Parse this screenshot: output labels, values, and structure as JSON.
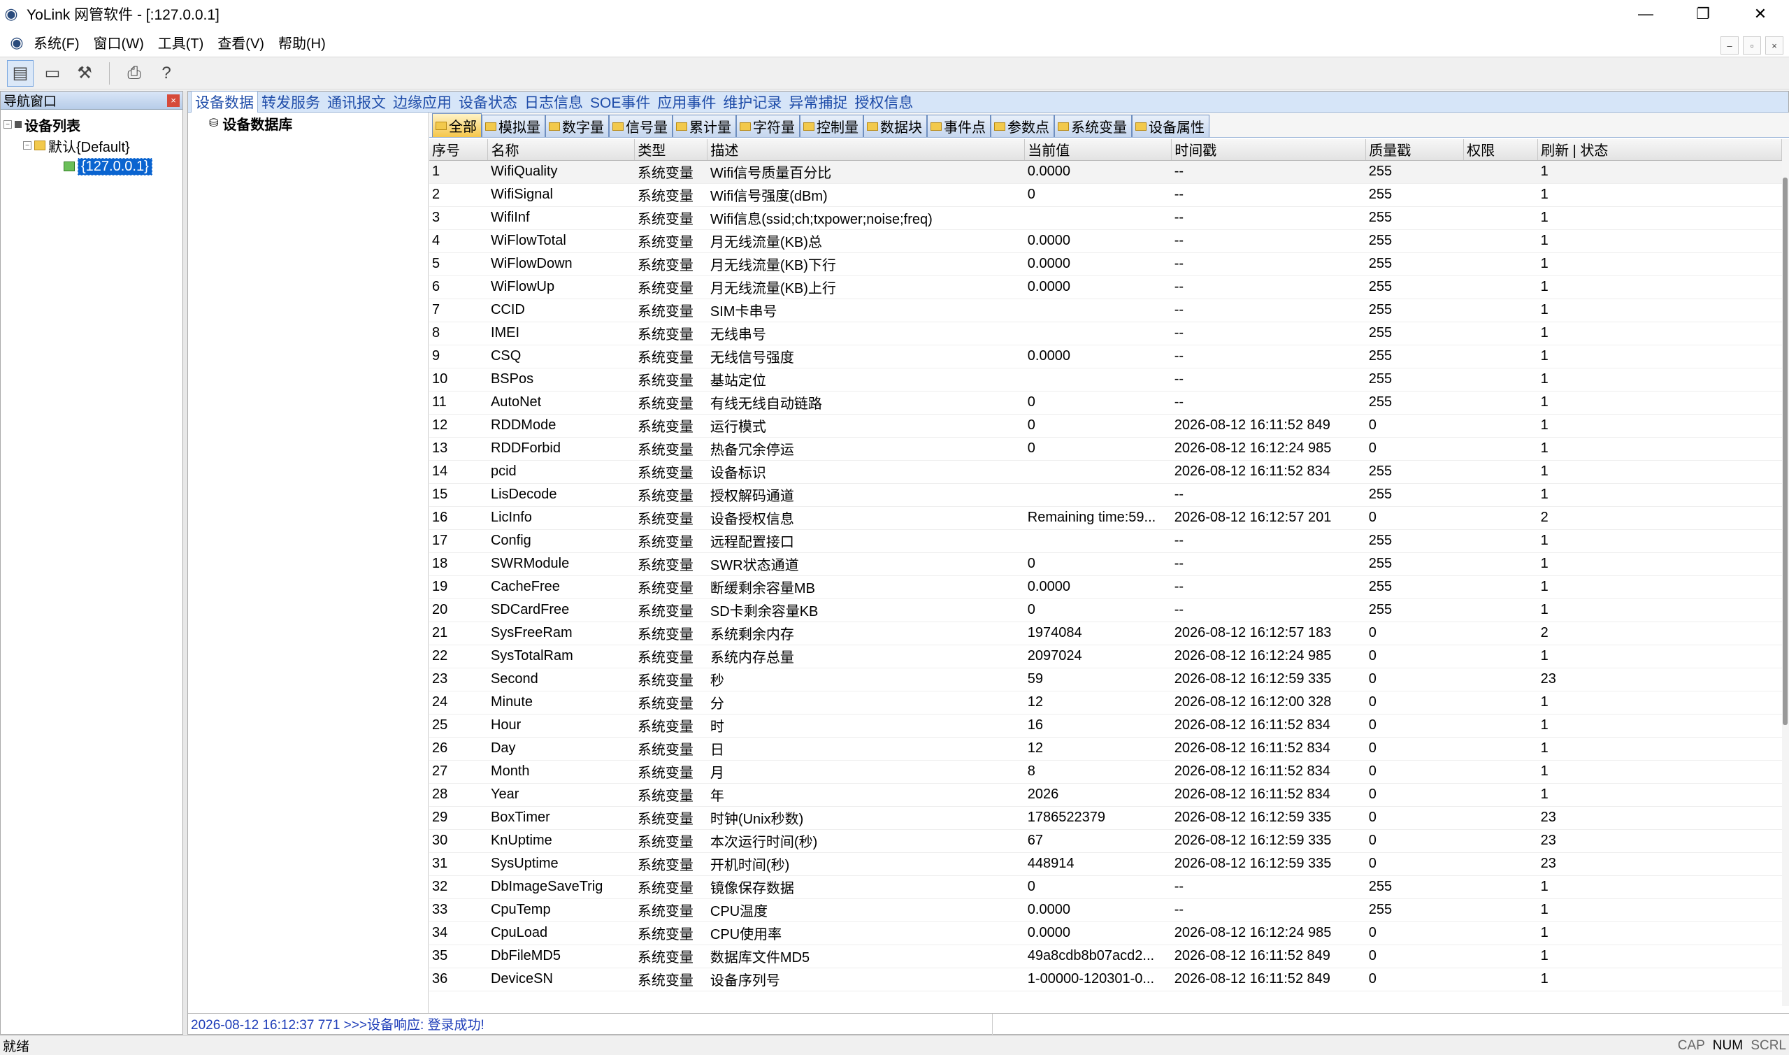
{
  "window": {
    "title": "YoLink 网管软件 - [:127.0.0.1]"
  },
  "menu": [
    "系统(F)",
    "窗口(W)",
    "工具(T)",
    "查看(V)",
    "帮助(H)"
  ],
  "nav": {
    "title": "导航窗口",
    "tree": {
      "root": "设备列表",
      "group": "默认{Default}",
      "device": "{127.0.0.1}"
    }
  },
  "tabs": [
    "设备数据",
    "转发服务",
    "通讯报文",
    "边缘应用",
    "设备状态",
    "日志信息",
    "SOE事件",
    "应用事件",
    "维护记录",
    "异常捕捉",
    "授权信息"
  ],
  "db_node": "设备数据库",
  "subtabs": [
    "全部",
    "模拟量",
    "数字量",
    "信号量",
    "累计量",
    "字符量",
    "控制量",
    "数据块",
    "事件点",
    "参数点",
    "系统变量",
    "设备属性"
  ],
  "columns": [
    "序号",
    "名称",
    "类型",
    "描述",
    "当前值",
    "时间戳",
    "质量戳",
    "权限",
    "刷新 | 状态"
  ],
  "rows": [
    [
      "1",
      "WifiQuality",
      "系统变量",
      "Wifi信号质量百分比",
      "0.0000",
      "--",
      "255",
      "",
      "1"
    ],
    [
      "2",
      "WifiSignal",
      "系统变量",
      "Wifi信号强度(dBm)",
      "0",
      "--",
      "255",
      "",
      "1"
    ],
    [
      "3",
      "WifiInf",
      "系统变量",
      "Wifi信息(ssid;ch;txpower;noise;freq)",
      "",
      "--",
      "255",
      "",
      "1"
    ],
    [
      "4",
      "WiFlowTotal",
      "系统变量",
      "月无线流量(KB)总",
      "0.0000",
      "--",
      "255",
      "",
      "1"
    ],
    [
      "5",
      "WiFlowDown",
      "系统变量",
      "月无线流量(KB)下行",
      "0.0000",
      "--",
      "255",
      "",
      "1"
    ],
    [
      "6",
      "WiFlowUp",
      "系统变量",
      "月无线流量(KB)上行",
      "0.0000",
      "--",
      "255",
      "",
      "1"
    ],
    [
      "7",
      "CCID",
      "系统变量",
      "SIM卡串号",
      "",
      "--",
      "255",
      "",
      "1"
    ],
    [
      "8",
      "IMEI",
      "系统变量",
      "无线串号",
      "",
      "--",
      "255",
      "",
      "1"
    ],
    [
      "9",
      "CSQ",
      "系统变量",
      "无线信号强度",
      "0.0000",
      "--",
      "255",
      "",
      "1"
    ],
    [
      "10",
      "BSPos",
      "系统变量",
      "基站定位",
      "",
      "--",
      "255",
      "",
      "1"
    ],
    [
      "11",
      "AutoNet",
      "系统变量",
      "有线无线自动链路",
      "0",
      "--",
      "255",
      "",
      "1"
    ],
    [
      "12",
      "RDDMode",
      "系统变量",
      "运行模式",
      "0",
      "2026-08-12 16:11:52 849",
      "0",
      "",
      "1"
    ],
    [
      "13",
      "RDDForbid",
      "系统变量",
      "热备冗余停运",
      "0",
      "2026-08-12 16:12:24 985",
      "0",
      "",
      "1"
    ],
    [
      "14",
      "pcid",
      "系统变量",
      "设备标识",
      "",
      "2026-08-12 16:11:52 834",
      "255",
      "",
      "1"
    ],
    [
      "15",
      "LisDecode",
      "系统变量",
      "授权解码通道",
      "",
      "--",
      "255",
      "",
      "1"
    ],
    [
      "16",
      "LicInfo",
      "系统变量",
      "设备授权信息",
      "Remaining time:59...",
      "2026-08-12 16:12:57 201",
      "0",
      "",
      "2"
    ],
    [
      "17",
      "Config",
      "系统变量",
      "远程配置接口",
      "",
      "--",
      "255",
      "",
      "1"
    ],
    [
      "18",
      "SWRModule",
      "系统变量",
      "SWR状态通道",
      "0",
      "--",
      "255",
      "",
      "1"
    ],
    [
      "19",
      "CacheFree",
      "系统变量",
      "断缓剩余容量MB",
      "0.0000",
      "--",
      "255",
      "",
      "1"
    ],
    [
      "20",
      "SDCardFree",
      "系统变量",
      "SD卡剩余容量KB",
      "0",
      "--",
      "255",
      "",
      "1"
    ],
    [
      "21",
      "SysFreeRam",
      "系统变量",
      "系统剩余内存",
      "1974084",
      "2026-08-12 16:12:57 183",
      "0",
      "",
      "2"
    ],
    [
      "22",
      "SysTotalRam",
      "系统变量",
      "系统内存总量",
      "2097024",
      "2026-08-12 16:12:24 985",
      "0",
      "",
      "1"
    ],
    [
      "23",
      "Second",
      "系统变量",
      "秒",
      "59",
      "2026-08-12 16:12:59 335",
      "0",
      "",
      "23"
    ],
    [
      "24",
      "Minute",
      "系统变量",
      "分",
      "12",
      "2026-08-12 16:12:00 328",
      "0",
      "",
      "1"
    ],
    [
      "25",
      "Hour",
      "系统变量",
      "时",
      "16",
      "2026-08-12 16:11:52 834",
      "0",
      "",
      "1"
    ],
    [
      "26",
      "Day",
      "系统变量",
      "日",
      "12",
      "2026-08-12 16:11:52 834",
      "0",
      "",
      "1"
    ],
    [
      "27",
      "Month",
      "系统变量",
      "月",
      "8",
      "2026-08-12 16:11:52 834",
      "0",
      "",
      "1"
    ],
    [
      "28",
      "Year",
      "系统变量",
      "年",
      "2026",
      "2026-08-12 16:11:52 834",
      "0",
      "",
      "1"
    ],
    [
      "29",
      "BoxTimer",
      "系统变量",
      "时钟(Unix秒数)",
      "1786522379",
      "2026-08-12 16:12:59 335",
      "0",
      "",
      "23"
    ],
    [
      "30",
      "KnUptime",
      "系统变量",
      "本次运行时间(秒)",
      "67",
      "2026-08-12 16:12:59 335",
      "0",
      "",
      "23"
    ],
    [
      "31",
      "SysUptime",
      "系统变量",
      "开机时间(秒)",
      "448914",
      "2026-08-12 16:12:59 335",
      "0",
      "",
      "23"
    ],
    [
      "32",
      "DbImageSaveTrig",
      "系统变量",
      "镜像保存数据",
      "0",
      "--",
      "255",
      "",
      "1"
    ],
    [
      "33",
      "CpuTemp",
      "系统变量",
      "CPU温度",
      "0.0000",
      "--",
      "255",
      "",
      "1"
    ],
    [
      "34",
      "CpuLoad",
      "系统变量",
      "CPU使用率",
      "0.0000",
      "2026-08-12 16:12:24 985",
      "0",
      "",
      "1"
    ],
    [
      "35",
      "DbFileMD5",
      "系统变量",
      "数据库文件MD5",
      "49a8cdb8b07acd2...",
      "2026-08-12 16:11:52 849",
      "0",
      "",
      "1"
    ],
    [
      "36",
      "DeviceSN",
      "系统变量",
      "设备序列号",
      "1-00000-120301-0...",
      "2026-08-12 16:11:52 849",
      "0",
      "",
      "1"
    ]
  ],
  "log": "2026-08-12 16:12:37 771 >>>设备响应: 登录成功!",
  "status": {
    "left": "就绪",
    "cap": "CAP",
    "num": "NUM",
    "scrl": "SCRL"
  }
}
